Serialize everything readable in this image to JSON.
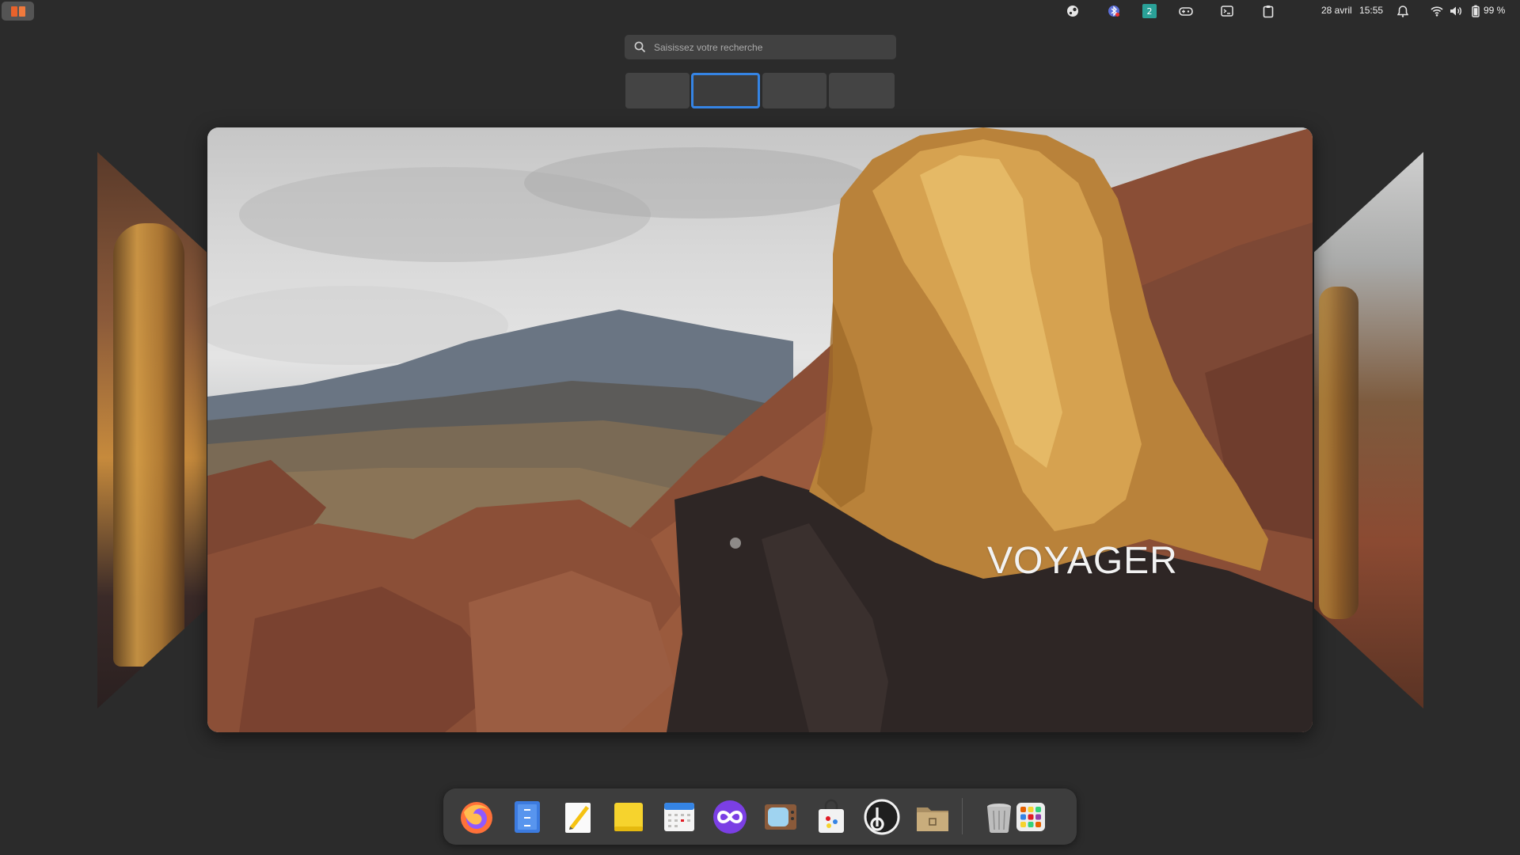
{
  "topbar": {
    "activities_icon": "activities-icon",
    "tray": [
      {
        "name": "steam-icon"
      },
      {
        "name": "bluetooth-icon"
      },
      {
        "name": "workspace-indicator-icon",
        "label": "2"
      },
      {
        "name": "gamepad-icon"
      },
      {
        "name": "terminal-icon"
      },
      {
        "name": "clipboard-icon"
      }
    ],
    "date": "28 avril",
    "time": "15:55",
    "alarm_icon": "alarm-clock-icon",
    "wifi_icon": "wifi-icon",
    "volume_icon": "volume-icon",
    "battery_icon": "battery-icon",
    "battery_text": "99 %"
  },
  "search": {
    "placeholder": "Saisissez votre recherche",
    "icon": "search-icon"
  },
  "workspaces": {
    "count": 4,
    "active_index": 1
  },
  "wallpaper": {
    "caption": "VOYAGER"
  },
  "dock": {
    "apps": [
      {
        "name": "firefox-icon"
      },
      {
        "name": "file-manager-icon"
      },
      {
        "name": "text-editor-icon"
      },
      {
        "name": "sticky-notes-icon"
      },
      {
        "name": "calendar-icon"
      },
      {
        "name": "infinity-app-icon"
      },
      {
        "name": "tv-app-icon"
      },
      {
        "name": "software-center-icon"
      },
      {
        "name": "b-app-icon"
      },
      {
        "name": "files-folder-icon"
      }
    ],
    "trash": "trash-icon",
    "app_grid": "app-grid-icon"
  },
  "colors": {
    "accent": "#3584e4",
    "background": "#2b2b2b",
    "activities": "#e8622b"
  }
}
